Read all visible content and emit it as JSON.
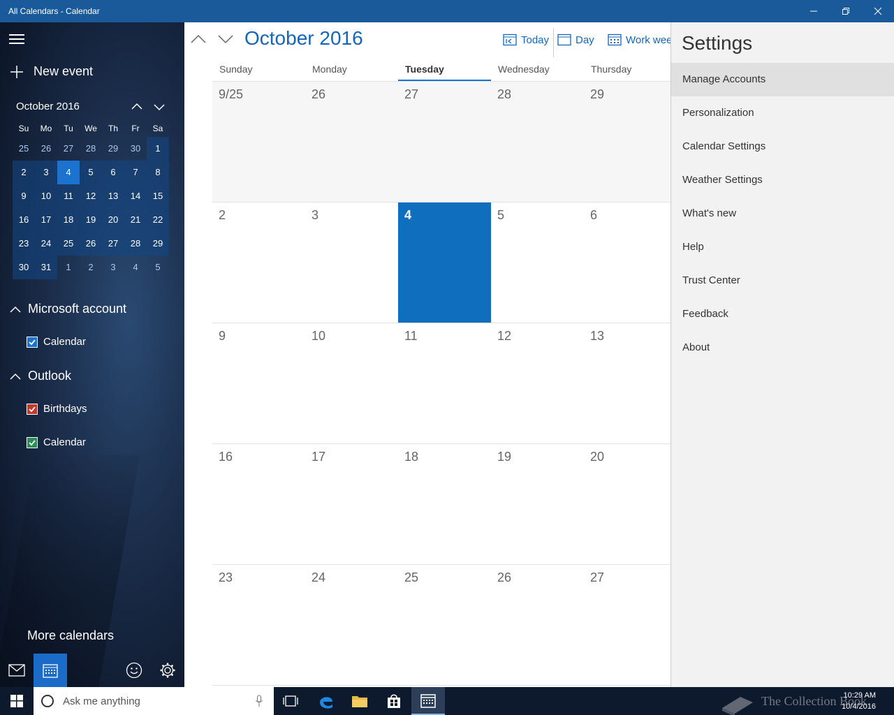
{
  "window": {
    "title": "All Calendars - Calendar"
  },
  "sidebar": {
    "new_event_label": "New event",
    "mini_calendar": {
      "title": "October 2016",
      "dow": [
        "Su",
        "Mo",
        "Tu",
        "We",
        "Th",
        "Fr",
        "Sa"
      ],
      "weeks": [
        [
          {
            "d": "25",
            "s": "out"
          },
          {
            "d": "26",
            "s": "out"
          },
          {
            "d": "27",
            "s": "out"
          },
          {
            "d": "28",
            "s": "out"
          },
          {
            "d": "29",
            "s": "out"
          },
          {
            "d": "30",
            "s": "out"
          },
          {
            "d": "1",
            "s": "in"
          }
        ],
        [
          {
            "d": "2",
            "s": "in"
          },
          {
            "d": "3",
            "s": "in"
          },
          {
            "d": "4",
            "s": "today"
          },
          {
            "d": "5",
            "s": "in"
          },
          {
            "d": "6",
            "s": "in"
          },
          {
            "d": "7",
            "s": "in"
          },
          {
            "d": "8",
            "s": "in"
          }
        ],
        [
          {
            "d": "9",
            "s": "in"
          },
          {
            "d": "10",
            "s": "in"
          },
          {
            "d": "11",
            "s": "in"
          },
          {
            "d": "12",
            "s": "in"
          },
          {
            "d": "13",
            "s": "in"
          },
          {
            "d": "14",
            "s": "in"
          },
          {
            "d": "15",
            "s": "in"
          }
        ],
        [
          {
            "d": "16",
            "s": "in"
          },
          {
            "d": "17",
            "s": "in"
          },
          {
            "d": "18",
            "s": "in"
          },
          {
            "d": "19",
            "s": "in"
          },
          {
            "d": "20",
            "s": "in"
          },
          {
            "d": "21",
            "s": "in"
          },
          {
            "d": "22",
            "s": "in"
          }
        ],
        [
          {
            "d": "23",
            "s": "in"
          },
          {
            "d": "24",
            "s": "in"
          },
          {
            "d": "25",
            "s": "in"
          },
          {
            "d": "26",
            "s": "in"
          },
          {
            "d": "27",
            "s": "in"
          },
          {
            "d": "28",
            "s": "in"
          },
          {
            "d": "29",
            "s": "in"
          }
        ],
        [
          {
            "d": "30",
            "s": "in"
          },
          {
            "d": "31",
            "s": "in"
          },
          {
            "d": "1",
            "s": "out"
          },
          {
            "d": "2",
            "s": "out"
          },
          {
            "d": "3",
            "s": "out"
          },
          {
            "d": "4",
            "s": "out"
          },
          {
            "d": "5",
            "s": "out"
          }
        ]
      ]
    },
    "groups": [
      {
        "name": "Microsoft account",
        "calendars": [
          {
            "label": "Calendar",
            "color": "#1a73d0"
          }
        ]
      },
      {
        "name": "Outlook",
        "calendars": [
          {
            "label": "Birthdays",
            "color": "#c0392b"
          },
          {
            "label": "Calendar",
            "color": "#2e8b57"
          }
        ]
      }
    ],
    "more_calendars_label": "More calendars"
  },
  "main": {
    "month_title": "October 2016",
    "views": {
      "today": "Today",
      "day": "Day",
      "work_week": "Work week"
    },
    "weekdays": [
      "Sunday",
      "Monday",
      "Tuesday",
      "Wednesday",
      "Thursday"
    ],
    "active_weekday": "Tuesday",
    "weeks": [
      [
        "9/25",
        "26",
        "27",
        "28",
        "29"
      ],
      [
        "2",
        "3",
        "4",
        "5",
        "6"
      ],
      [
        "9",
        "10",
        "11",
        "12",
        "13"
      ],
      [
        "16",
        "17",
        "18",
        "19",
        "20"
      ],
      [
        "23",
        "24",
        "25",
        "26",
        "27"
      ]
    ],
    "today_cell": "4"
  },
  "settings": {
    "title": "Settings",
    "items": [
      "Manage Accounts",
      "Personalization",
      "Calendar Settings",
      "Weather Settings",
      "What's new",
      "Help",
      "Trust Center",
      "Feedback",
      "About"
    ],
    "highlighted": "Manage Accounts"
  },
  "taskbar": {
    "search_placeholder": "Ask me anything",
    "time": "10:29 AM",
    "date": "10/4/2016",
    "watermark": "The Collection Book"
  },
  "colors": {
    "accent": "#106ebe",
    "titlebar": "#1a5a9a",
    "taskbar": "#0d1a2e"
  }
}
